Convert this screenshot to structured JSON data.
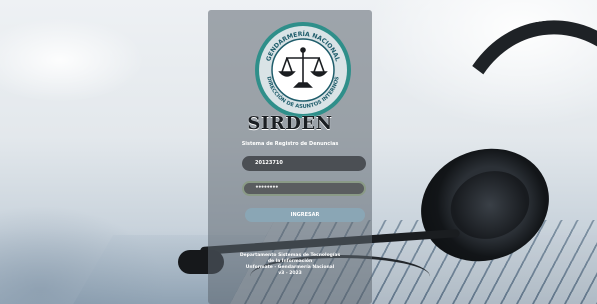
{
  "logo": {
    "ring_top_text": "GENDARMERÍA NACIONAL",
    "ring_bottom_text": "DIRECCIÓN DE ASUNTOS INTERNOS",
    "colors": {
      "outer": "#2f8f8a",
      "inner": "#ffffff",
      "ring": "#1f5d6b",
      "emblem": "#1a1d20"
    }
  },
  "app": {
    "name": "SIRDEN",
    "subtitle": "Sistema de Registro de Denuncias"
  },
  "login": {
    "username_value": "20123710",
    "password_masked": "••••••••",
    "submit_label": "INGRESAR"
  },
  "footer": {
    "line1": "Departamento Sistemas de Tecnologías",
    "line2": "de la Información",
    "line3": "Unformate - Gendarmería Nacional",
    "line4": "v3 - 2023"
  },
  "colors": {
    "panel": "#5c6670",
    "field": "#4b4f54",
    "button": "#8aa6b5"
  }
}
